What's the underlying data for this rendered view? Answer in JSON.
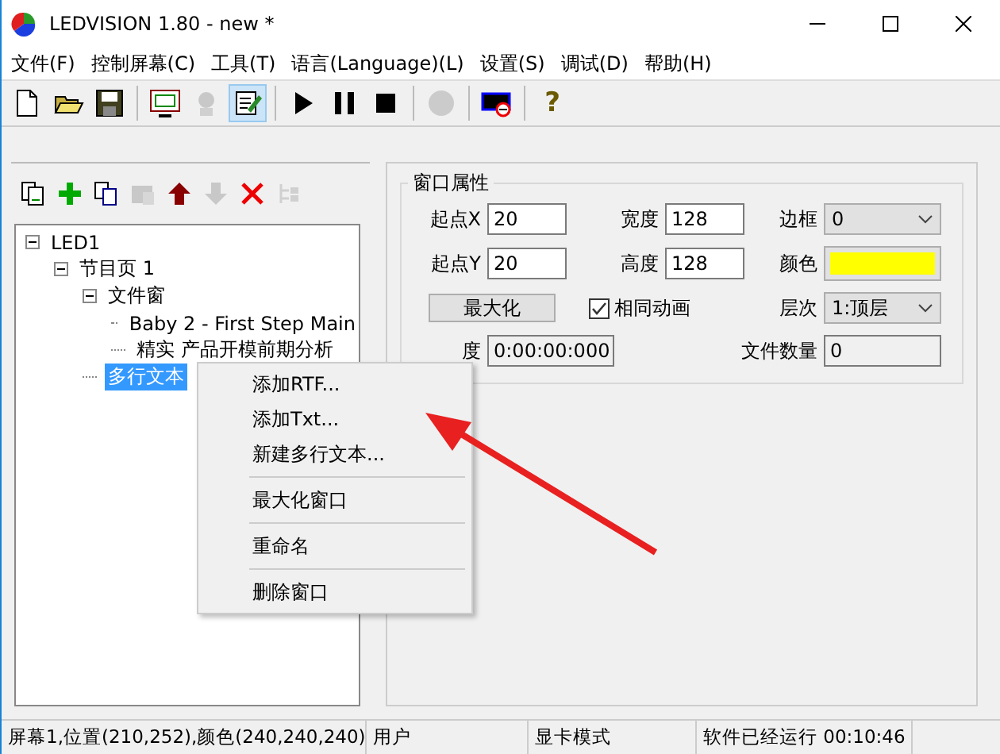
{
  "window": {
    "title": "LEDVISION 1.80 - new *"
  },
  "menu_bar": [
    "文件(F)",
    "控制屏幕(C)",
    "工具(T)",
    "语言(Language)(L)",
    "设置(S)",
    "调试(D)",
    "帮助(H)"
  ],
  "toolbar": [
    {
      "kind": "new",
      "disabled": false,
      "selected": false
    },
    {
      "kind": "open",
      "disabled": false,
      "selected": false
    },
    {
      "kind": "save",
      "disabled": false,
      "selected": false
    },
    {
      "kind": "separator"
    },
    {
      "kind": "screen",
      "disabled": false,
      "selected": false
    },
    {
      "kind": "network",
      "disabled": true,
      "selected": false
    },
    {
      "kind": "edit",
      "disabled": false,
      "selected": true
    },
    {
      "kind": "separator"
    },
    {
      "kind": "play",
      "disabled": false,
      "selected": false
    },
    {
      "kind": "pause",
      "disabled": false,
      "selected": false
    },
    {
      "kind": "stop",
      "disabled": false,
      "selected": false
    },
    {
      "kind": "separator"
    },
    {
      "kind": "record",
      "disabled": true,
      "selected": false
    },
    {
      "kind": "separator"
    },
    {
      "kind": "display",
      "disabled": false,
      "selected": false
    },
    {
      "kind": "separator"
    },
    {
      "kind": "help",
      "label": "?",
      "disabled": false,
      "selected": false
    }
  ],
  "tree_toolbar": [
    {
      "kind": "pages",
      "disabled": false
    },
    {
      "kind": "add",
      "disabled": false
    },
    {
      "kind": "copy",
      "disabled": false
    },
    {
      "kind": "paste",
      "disabled": true
    },
    {
      "kind": "up",
      "disabled": false
    },
    {
      "kind": "down",
      "disabled": true
    },
    {
      "kind": "delete",
      "disabled": false
    },
    {
      "kind": "structure",
      "disabled": true
    }
  ],
  "tree": [
    {
      "label": "LED1",
      "expanded": true,
      "selected": false,
      "children": [
        {
          "label": "节目页 1",
          "expanded": true,
          "selected": false,
          "children": [
            {
              "label": "文件窗",
              "expanded": true,
              "selected": false,
              "children": [
                {
                  "label": "Baby 2 - First Step Main",
                  "selected": false
                },
                {
                  "label": "精实  产品开模前期分析",
                  "selected": false
                }
              ]
            },
            {
              "label": "多行文本",
              "selected": true
            }
          ]
        }
      ]
    }
  ],
  "properties": {
    "title": "窗口属性",
    "start_x": {
      "label": "起点X",
      "value": "20"
    },
    "width": {
      "label": "宽度",
      "value": "128"
    },
    "border": {
      "label": "边框",
      "value": "0"
    },
    "start_y": {
      "label": "起点Y",
      "value": "20"
    },
    "height": {
      "label": "高度",
      "value": "128"
    },
    "color": {
      "label": "颜色",
      "color": "#ffff00"
    },
    "maximize_button": "最大化",
    "same_animation": {
      "label": "相同动画",
      "checked": true
    },
    "layer": {
      "label": "层次",
      "value": "1:顶层"
    },
    "duration": {
      "label": "度",
      "value": "0:00:00:000"
    },
    "file_count": {
      "label": "文件数量",
      "value": "0"
    }
  },
  "context_menu": [
    [
      "添加RTF...",
      "添加Txt...",
      "新建多行文本..."
    ],
    [
      "最大化窗口"
    ],
    [
      "重命名"
    ],
    [
      "删除窗口"
    ]
  ],
  "status_bar": [
    "屏幕1,位置(210,252),颜色(240,240,240)",
    "用户",
    "显卡模式",
    "软件已经运行 00:10:46"
  ]
}
